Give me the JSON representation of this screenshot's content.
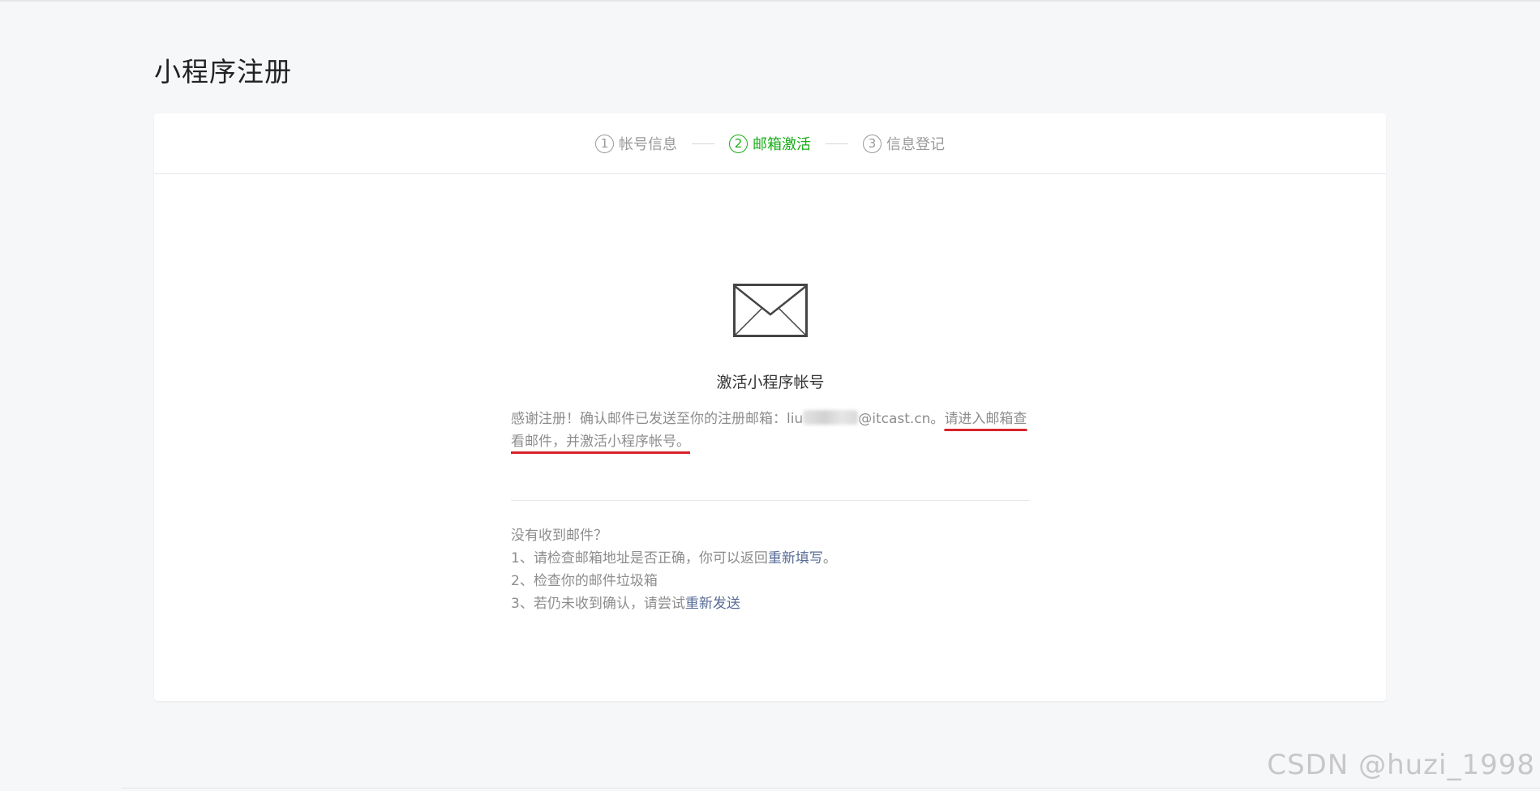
{
  "page": {
    "title": "小程序注册"
  },
  "steps": [
    {
      "num": "1",
      "label": "帐号信息",
      "active": false
    },
    {
      "num": "2",
      "label": "邮箱激活",
      "active": true
    },
    {
      "num": "3",
      "label": "信息登记",
      "active": false
    }
  ],
  "activation": {
    "icon": "envelope-icon",
    "heading": "激活小程序帐号",
    "msg_prefix": "感谢注册！确认邮件已发送至你的注册邮箱：liu",
    "msg_email_suffix": "@itcast.cn。",
    "msg_emphasis": "请进入邮箱查看邮件，并激活小程序帐号。"
  },
  "help": {
    "question": "没有收到邮件？",
    "item1_prefix": "1、请检查邮箱地址是否正确，你可以返回",
    "item1_link": "重新填写",
    "item1_suffix": "。",
    "item2": "2、检查你的邮件垃圾箱",
    "item3_prefix": "3、若仍未收到确认，请尝试",
    "item3_link": "重新发送"
  },
  "watermark": "CSDN @huzi_1998",
  "colors": {
    "accent": "#1aad19",
    "link": "#576b95",
    "annotation": "#d8232a"
  }
}
